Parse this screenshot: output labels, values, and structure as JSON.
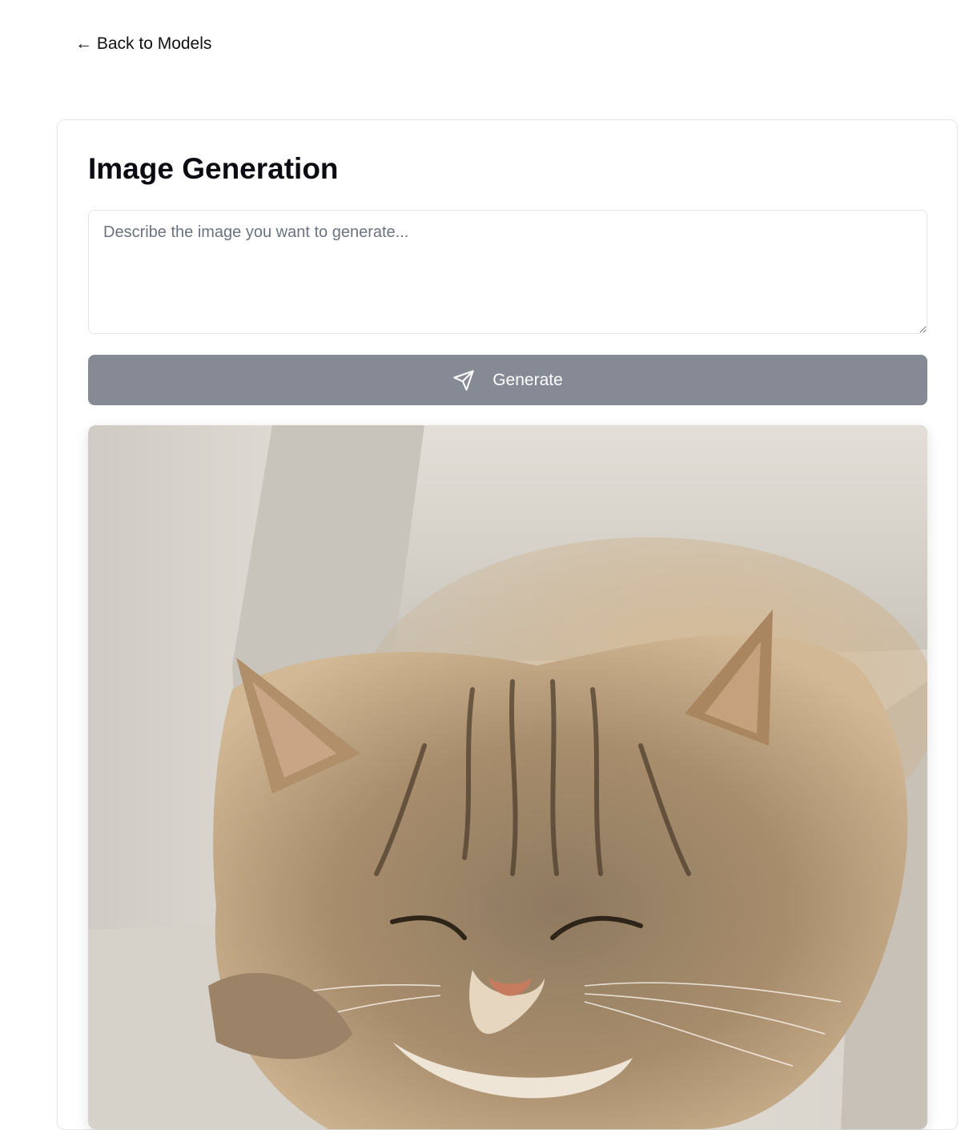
{
  "nav": {
    "back_label": "← Back to Models"
  },
  "page": {
    "title": "Image Generation"
  },
  "prompt": {
    "placeholder": "Describe the image you want to generate...",
    "value": ""
  },
  "actions": {
    "generate_label": "Generate",
    "generate_icon": "send-icon"
  },
  "colors": {
    "button_disabled": "#868a94",
    "card_border": "#e5e7eb"
  }
}
